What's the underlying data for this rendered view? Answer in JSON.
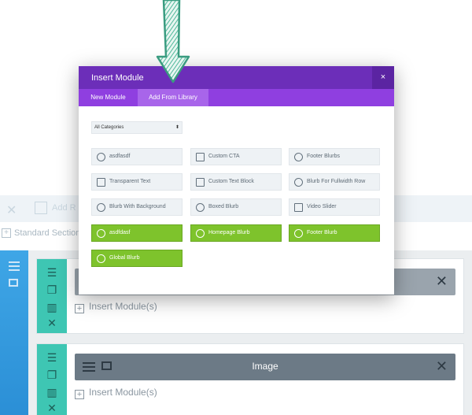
{
  "background": {
    "faded_bar": {
      "add_label": "Add R"
    },
    "standard_section_label": "Standard Section",
    "rows": [
      {
        "module_title": "",
        "insert_label": "Insert Module(s)"
      },
      {
        "module_title": "Image",
        "insert_label": "Insert Module(s)"
      }
    ]
  },
  "modal": {
    "title": "Insert Module",
    "close_label": "×",
    "tabs": [
      {
        "label": "New Module",
        "active": false
      },
      {
        "label": "Add From Library",
        "active": true
      }
    ],
    "category_select": {
      "value": "All Categories",
      "arrow": "⬍"
    },
    "modules": [
      {
        "label": "asdfasdf",
        "icon": "speech-bubble-icon",
        "green": false
      },
      {
        "label": "Custom CTA",
        "icon": "cursor-click-icon",
        "green": false
      },
      {
        "label": "Footer Blurbs",
        "icon": "speech-bubble-icon",
        "green": false
      },
      {
        "label": "Transparent Text",
        "icon": "text-block-icon",
        "green": false
      },
      {
        "label": "Custom Text Block",
        "icon": "text-block-icon",
        "green": false
      },
      {
        "label": "Blurb For Fullwidth Row",
        "icon": "speech-bubble-icon",
        "green": false
      },
      {
        "label": "Blurb With Background",
        "icon": "speech-bubble-icon",
        "green": false
      },
      {
        "label": "Boxed Blurb",
        "icon": "speech-bubble-icon",
        "green": false
      },
      {
        "label": "Video Slider",
        "icon": "camera-icon",
        "green": false
      },
      {
        "label": "asdfdasf",
        "icon": "speech-bubble-icon",
        "green": true
      },
      {
        "label": "Homepage Blurb",
        "icon": "speech-bubble-icon",
        "green": true
      },
      {
        "label": "Footer Blurb",
        "icon": "speech-bubble-icon",
        "green": true
      },
      {
        "label": "Global Blurb",
        "icon": "speech-bubble-icon",
        "green": true
      }
    ]
  },
  "colors": {
    "modal_header": "#6c2eb9",
    "modal_tabs": "#8f3fe0",
    "global_module_green": "#7ec32c",
    "row_teal": "#3ec6b3",
    "section_blue": "#2b8fd6",
    "arrow_green": "#4fb89a"
  }
}
